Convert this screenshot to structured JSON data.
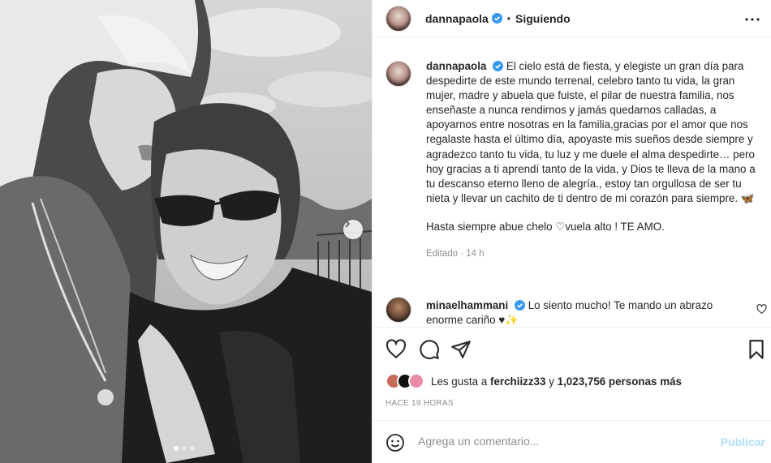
{
  "post": {
    "username": "dannapaola",
    "follow_status": "Siguiendo",
    "separator": "•"
  },
  "caption": {
    "username": "dannapaola",
    "text": "El cielo está de fiesta, y elegiste un gran día para despedirte de este mundo terrenal, celebro tanto tu vida, la gran mujer, madre y abuela que fuiste, el pilar de nuestra familia, nos enseñaste a nunca rendirnos y jamás quedarnos calladas, a apoyarnos entre nosotras en la familia,gracias por el amor que nos regalaste hasta el último día, apoyaste mis sueños desde siempre y agradezco tanto tu vida, tu luz y me duele el alma despedirte… pero hoy gracias a ti aprendí tanto de la vida, y Dios te lleva de la mano a tu descanso eterno lleno de alegría., estoy tan orgullosa de ser tu nieta y llevar un cachito de ti dentro de mi corazón para siempre. 🦋",
    "closing_before": "Hasta siempre abue chelo ",
    "closing_heart": "♡",
    "closing_after": "vuela alto ! TE AMO.",
    "edited": "Editado",
    "dot": "·",
    "time": "14 h"
  },
  "comment": {
    "username": "minaelhammani",
    "text": "Lo siento mucho! Te mando un abrazo enorme cariño ♥✨"
  },
  "likes": {
    "prefix": "Les gusta a",
    "user": "ferchiizz33",
    "and": "y",
    "count": "1,023,756 personas más"
  },
  "timestamp": "HACE 19 HORAS",
  "add_comment": {
    "placeholder": "Agrega un comentario...",
    "publish": "Publicar"
  },
  "icons": {
    "verified": "verified-badge-icon",
    "more": "more-options-icon",
    "like": "heart-outline-icon",
    "comment": "comment-bubble-icon",
    "share": "paper-plane-icon",
    "save": "bookmark-icon",
    "emoji": "smiley-icon",
    "carousel": "chevron-right-icon"
  },
  "colors": {
    "verified": "#3897f0",
    "publish_disabled": "#b2dffc",
    "muted": "#8e8e8e",
    "text": "#262626"
  },
  "carousel": {
    "slides": 3,
    "active": 1
  }
}
